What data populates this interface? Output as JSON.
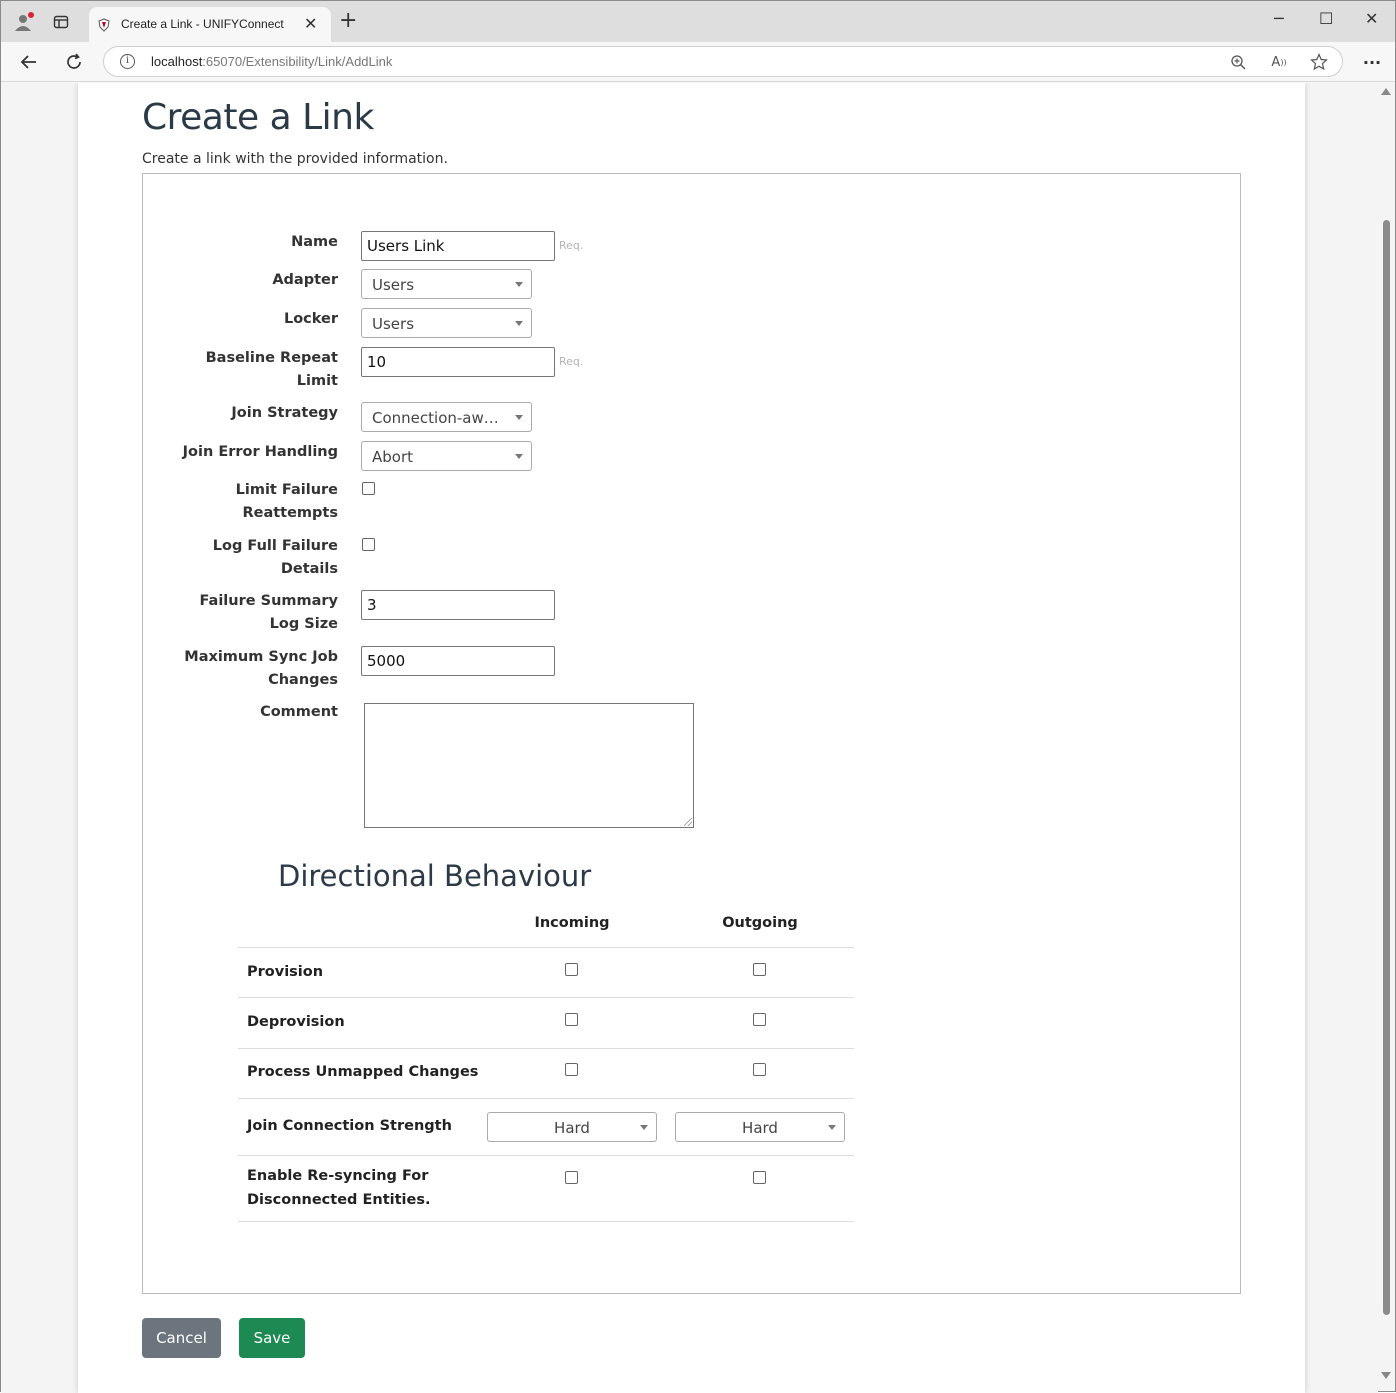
{
  "browser": {
    "tab_title": "Create a Link - UNIFYConnect",
    "url_host": "localhost",
    "url_rest": ":65070/Extensibility/Link/AddLink"
  },
  "page": {
    "title": "Create a Link",
    "subtitle": "Create a link with the provided information."
  },
  "form": {
    "name_label": "Name",
    "name_value": "Users Link",
    "req": "Req.",
    "adapter_label": "Adapter",
    "adapter_value": "Users",
    "locker_label": "Locker",
    "locker_value": "Users",
    "baseline_label_1": "Baseline Repeat",
    "baseline_label_2": "Limit",
    "baseline_value": "10",
    "join_strategy_label": "Join Strategy",
    "join_strategy_value": "Connection-awar...",
    "join_error_label": "Join Error Handling",
    "join_error_value": "Abort",
    "limit_failure_label_1": "Limit Failure",
    "limit_failure_label_2": "Reattempts",
    "log_full_label_1": "Log Full Failure",
    "log_full_label_2": "Details",
    "failure_summary_label_1": "Failure Summary",
    "failure_summary_label_2": "Log Size",
    "failure_summary_value": "3",
    "max_sync_label_1": "Maximum Sync Job",
    "max_sync_label_2": "Changes",
    "max_sync_value": "5000",
    "comment_label": "Comment"
  },
  "directional": {
    "title": "Directional Behaviour",
    "incoming": "Incoming",
    "outgoing": "Outgoing",
    "provision": "Provision",
    "deprovision": "Deprovision",
    "unmapped": "Process Unmapped Changes",
    "join_strength": "Join Connection Strength",
    "join_strength_in": "Hard",
    "join_strength_out": "Hard",
    "resync_1": "Enable Re-syncing For",
    "resync_2": "Disconnected Entities."
  },
  "buttons": {
    "cancel": "Cancel",
    "save": "Save"
  }
}
